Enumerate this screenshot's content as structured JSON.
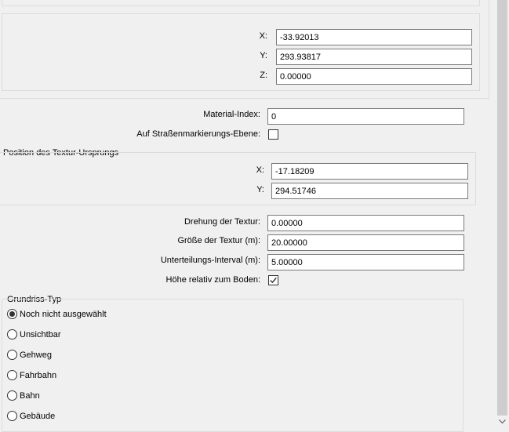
{
  "start_coords": {
    "x_label": "X:",
    "x_value": "-33.92013",
    "y_label": "Y:",
    "y_value": "293.93817",
    "z_label": "Z:",
    "z_value": "0.00000"
  },
  "material": {
    "label": "Material-Index:",
    "value": "0"
  },
  "road_marking": {
    "label": "Auf Straßenmarkierungs-Ebene:",
    "checked": false
  },
  "texture_origin": {
    "title": "Position des Textur-Ursprungs",
    "x_label": "X:",
    "x_value": "-17.18209",
    "y_label": "Y:",
    "y_value": "294.51746"
  },
  "texture_props": {
    "rotation_label": "Drehung der Textur:",
    "rotation_value": "0.00000",
    "size_label": "Größe der Textur (m):",
    "size_value": "20.00000",
    "interval_label": "Unterteilungs-Interval (m):",
    "interval_value": "5.00000",
    "relative_label": "Höhe relativ zum Boden:",
    "relative_checked": true
  },
  "footprint": {
    "title": "Grundriss-Typ",
    "options": [
      {
        "label": "Noch nicht ausgewählt",
        "checked": true
      },
      {
        "label": "Unsichtbar",
        "checked": false
      },
      {
        "label": "Gehweg",
        "checked": false
      },
      {
        "label": "Fahrbahn",
        "checked": false
      },
      {
        "label": "Bahn",
        "checked": false
      },
      {
        "label": "Gebäude",
        "checked": false
      }
    ]
  }
}
